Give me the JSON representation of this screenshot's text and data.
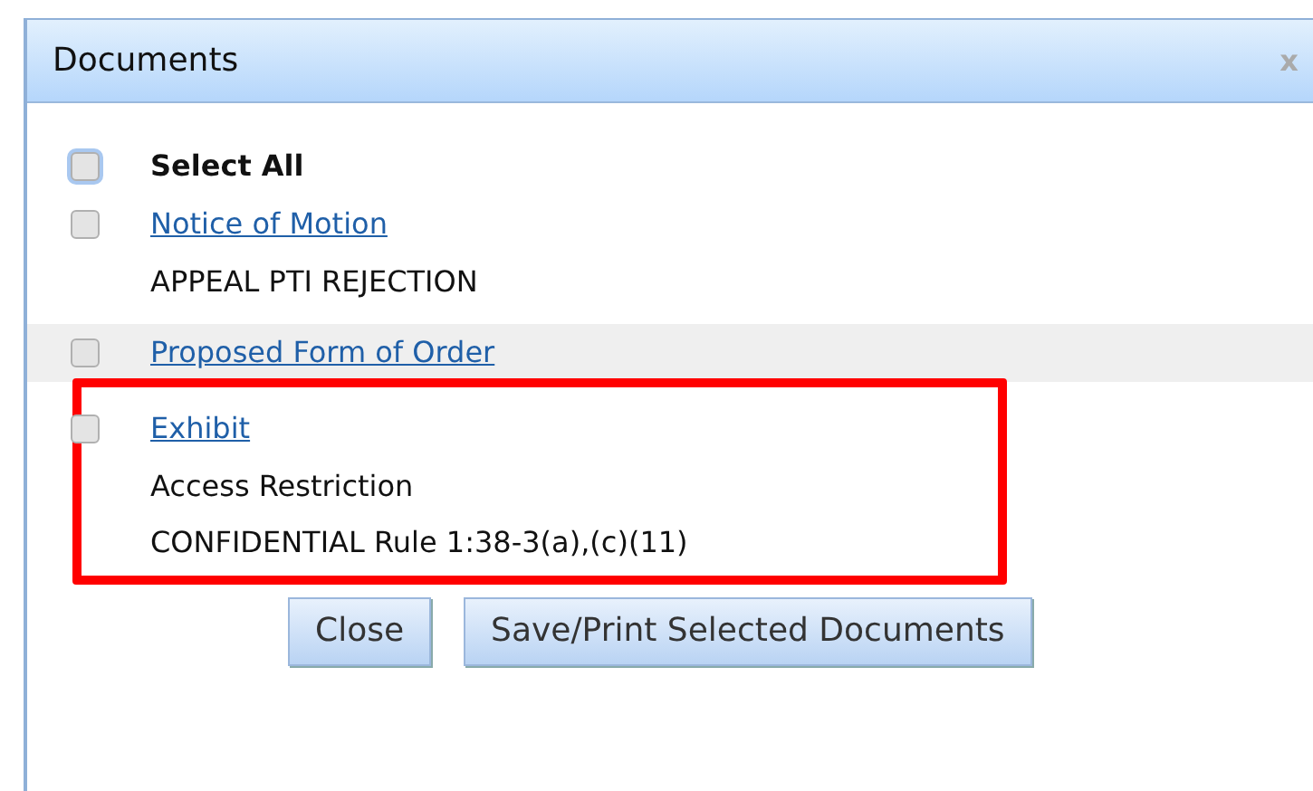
{
  "dialog": {
    "title": "Documents",
    "close_glyph": "x"
  },
  "select_all": {
    "label": "Select All",
    "checked": false,
    "focused": true
  },
  "documents": [
    {
      "title": "Notice of Motion",
      "checked": false,
      "shaded": false,
      "lines": [
        "APPEAL PTI REJECTION"
      ]
    },
    {
      "title": "Proposed Form of Order",
      "checked": false,
      "shaded": true
    },
    {
      "title": "Exhibit",
      "checked": false,
      "shaded": false,
      "lines": [
        "Access Restriction",
        "CONFIDENTIAL Rule 1:38-3(a),(c)(11)"
      ]
    }
  ],
  "buttons": [
    "Close",
    "Save/Print Selected Documents"
  ]
}
